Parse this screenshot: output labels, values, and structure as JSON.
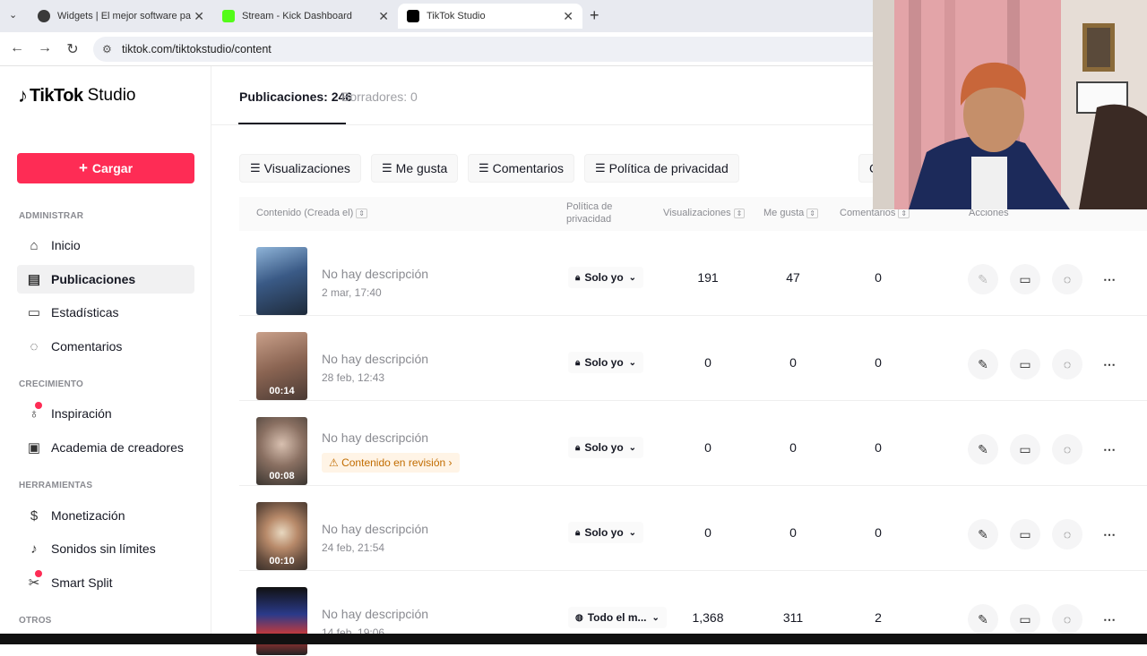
{
  "browser": {
    "tabs": [
      {
        "title": "Widgets | El mejor software pa",
        "favicon_color": "#3a3a3a"
      },
      {
        "title": "Stream - Kick Dashboard",
        "favicon_color": "#53fc18"
      },
      {
        "title": "TikTok Studio",
        "favicon_color": "#000000"
      }
    ],
    "url": "tiktok.com/tiktokstudio/content"
  },
  "sidebar": {
    "logo_tiktok": "TikTok",
    "logo_studio": "Studio",
    "upload_label": "Cargar",
    "sections": {
      "admin": "ADMINISTRAR",
      "growth": "CRECIMIENTO",
      "tools": "HERRAMIENTAS",
      "others": "OTROS"
    },
    "items": [
      {
        "label": "Inicio",
        "icon": "home-icon"
      },
      {
        "label": "Publicaciones",
        "icon": "posts-icon"
      },
      {
        "label": "Estadísticas",
        "icon": "analytics-icon"
      },
      {
        "label": "Comentarios",
        "icon": "comments-icon"
      },
      {
        "label": "Inspiración",
        "icon": "bulb-icon"
      },
      {
        "label": "Academia de creadores",
        "icon": "academy-icon"
      },
      {
        "label": "Monetización",
        "icon": "dollar-icon"
      },
      {
        "label": "Sonidos sin límites",
        "icon": "music-icon"
      },
      {
        "label": "Smart Split",
        "icon": "scissors-icon"
      }
    ]
  },
  "main": {
    "tabs": [
      "Publicaciones: 246",
      "Borradores: 0"
    ],
    "filters": [
      "Visualizaciones",
      "Me gusta",
      "Comentarios",
      "Política de privacidad",
      "C"
    ],
    "columns": {
      "content": "Contenido (Creada el)",
      "privacy_1": "Política de",
      "privacy_2": "privacidad",
      "views": "Visualizaciones",
      "likes": "Me gusta",
      "comments": "Comentarios",
      "actions": "Acciones"
    },
    "rows": [
      {
        "description": "No hay descripción",
        "date": "2 mar, 17:40",
        "duration": "",
        "privacy": "Solo yo",
        "views": "191",
        "likes": "47",
        "comments": "0"
      },
      {
        "description": "No hay descripción",
        "date": "28 feb, 12:43",
        "duration": "00:14",
        "privacy": "Solo yo",
        "views": "0",
        "likes": "0",
        "comments": "0"
      },
      {
        "description": "No hay descripción",
        "review": "Contenido en revisión",
        "duration": "00:08",
        "privacy": "Solo yo",
        "views": "0",
        "likes": "0",
        "comments": "0"
      },
      {
        "description": "No hay descripción",
        "date": "24 feb, 21:54",
        "duration": "00:10",
        "privacy": "Solo yo",
        "views": "0",
        "likes": "0",
        "comments": "0"
      },
      {
        "description": "No hay descripción",
        "date": "14 feb, 19:06",
        "duration": "",
        "privacy": "Todo el m...",
        "views": "1,368",
        "likes": "311",
        "comments": "2"
      }
    ]
  },
  "colors": {
    "accent": "#fe2c55",
    "review_bg": "#fff4e6"
  }
}
